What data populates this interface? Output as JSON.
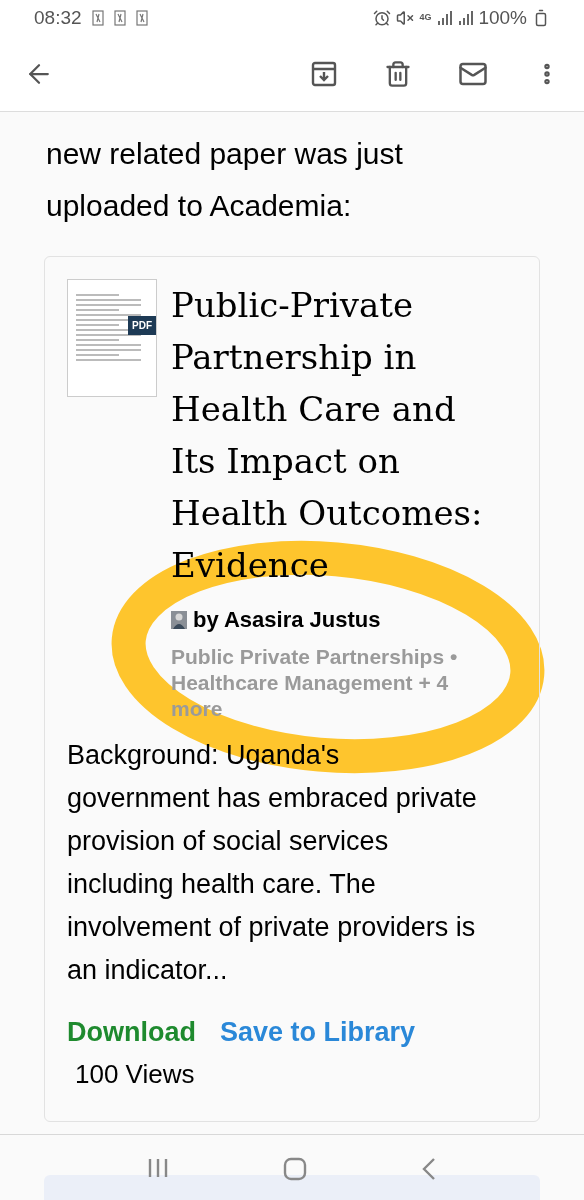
{
  "status_bar": {
    "time": "08:32",
    "network": "4G",
    "battery": "100%"
  },
  "message_lines": [
    "new related paper was just",
    "uploaded to Academia:"
  ],
  "paper": {
    "thumbnail_badge": "PDF",
    "title": "Public-Private Partnership in Health Care and Its Impact on Health Outcomes: Evidence",
    "author": "by Asasira Justus",
    "tags": "Public Private Partnerships • Healthcare Management + 4 more",
    "abstract": "Background: Uganda's government has embraced private provision of social services including health care. The involvement of private providers is an indicator...",
    "actions": [
      {
        "label": "Download",
        "color": "#1e8a2e"
      },
      {
        "label": "Save to Library",
        "color": "#2a88d8"
      }
    ],
    "views": "100 Views"
  }
}
